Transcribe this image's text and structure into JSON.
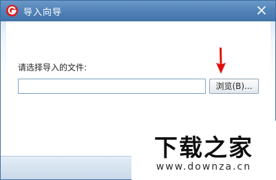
{
  "window": {
    "title": "导入向导"
  },
  "form": {
    "prompt_label": "请选择导入的文件:",
    "file_path_value": "",
    "browse_label": "浏览(B)..."
  },
  "watermark": {
    "title": "下载之家",
    "url": "www.downza.cn"
  },
  "icons": {
    "app_logo": "red-g-logo",
    "close": "close-icon",
    "annotation": "red-arrow"
  },
  "colors": {
    "titlebar": "#4f80b5",
    "arrow": "#e01010"
  }
}
